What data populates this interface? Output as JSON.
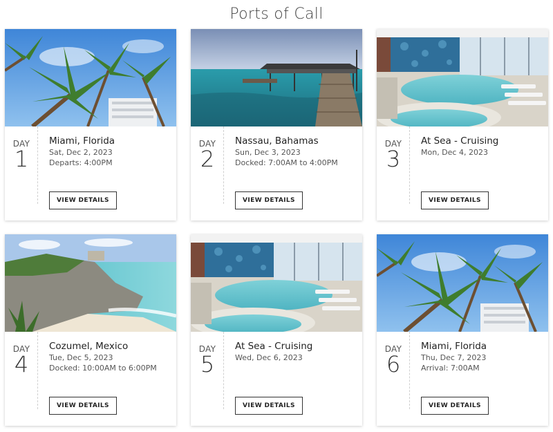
{
  "page": {
    "title": "Ports of Call"
  },
  "cards": [
    {
      "day_label": "DAY",
      "day_number": "1",
      "port": "Miami, Florida",
      "lines": [
        "Sat, Dec 2, 2023",
        "Departs: 4:00PM"
      ],
      "button": "VIEW DETAILS",
      "image": "palm-trees-sky"
    },
    {
      "day_label": "DAY",
      "day_number": "2",
      "port": "Nassau, Bahamas",
      "lines": [
        "Sun, Dec 3, 2023",
        "Docked: 7:00AM to 4:00PM"
      ],
      "button": "VIEW DETAILS",
      "image": "pier-ocean"
    },
    {
      "day_label": "DAY",
      "day_number": "3",
      "port": "At Sea - Cruising",
      "lines": [
        "Mon, Dec 4, 2023",
        ""
      ],
      "button": "VIEW DETAILS",
      "image": "ship-pool-deck"
    },
    {
      "day_label": "DAY",
      "day_number": "4",
      "port": "Cozumel, Mexico",
      "lines": [
        "Tue, Dec 5, 2023",
        "Docked: 10:00AM to 6:00PM"
      ],
      "button": "VIEW DETAILS",
      "image": "coastal-ruins-beach"
    },
    {
      "day_label": "DAY",
      "day_number": "5",
      "port": "At Sea - Cruising",
      "lines": [
        "Wed, Dec 6, 2023",
        ""
      ],
      "button": "VIEW DETAILS",
      "image": "ship-pool-deck"
    },
    {
      "day_label": "DAY",
      "day_number": "6",
      "port": "Miami, Florida",
      "lines": [
        "Thu, Dec 7, 2023",
        "Arrival: 7:00AM"
      ],
      "button": "VIEW DETAILS",
      "image": "palm-trees-sky"
    }
  ]
}
